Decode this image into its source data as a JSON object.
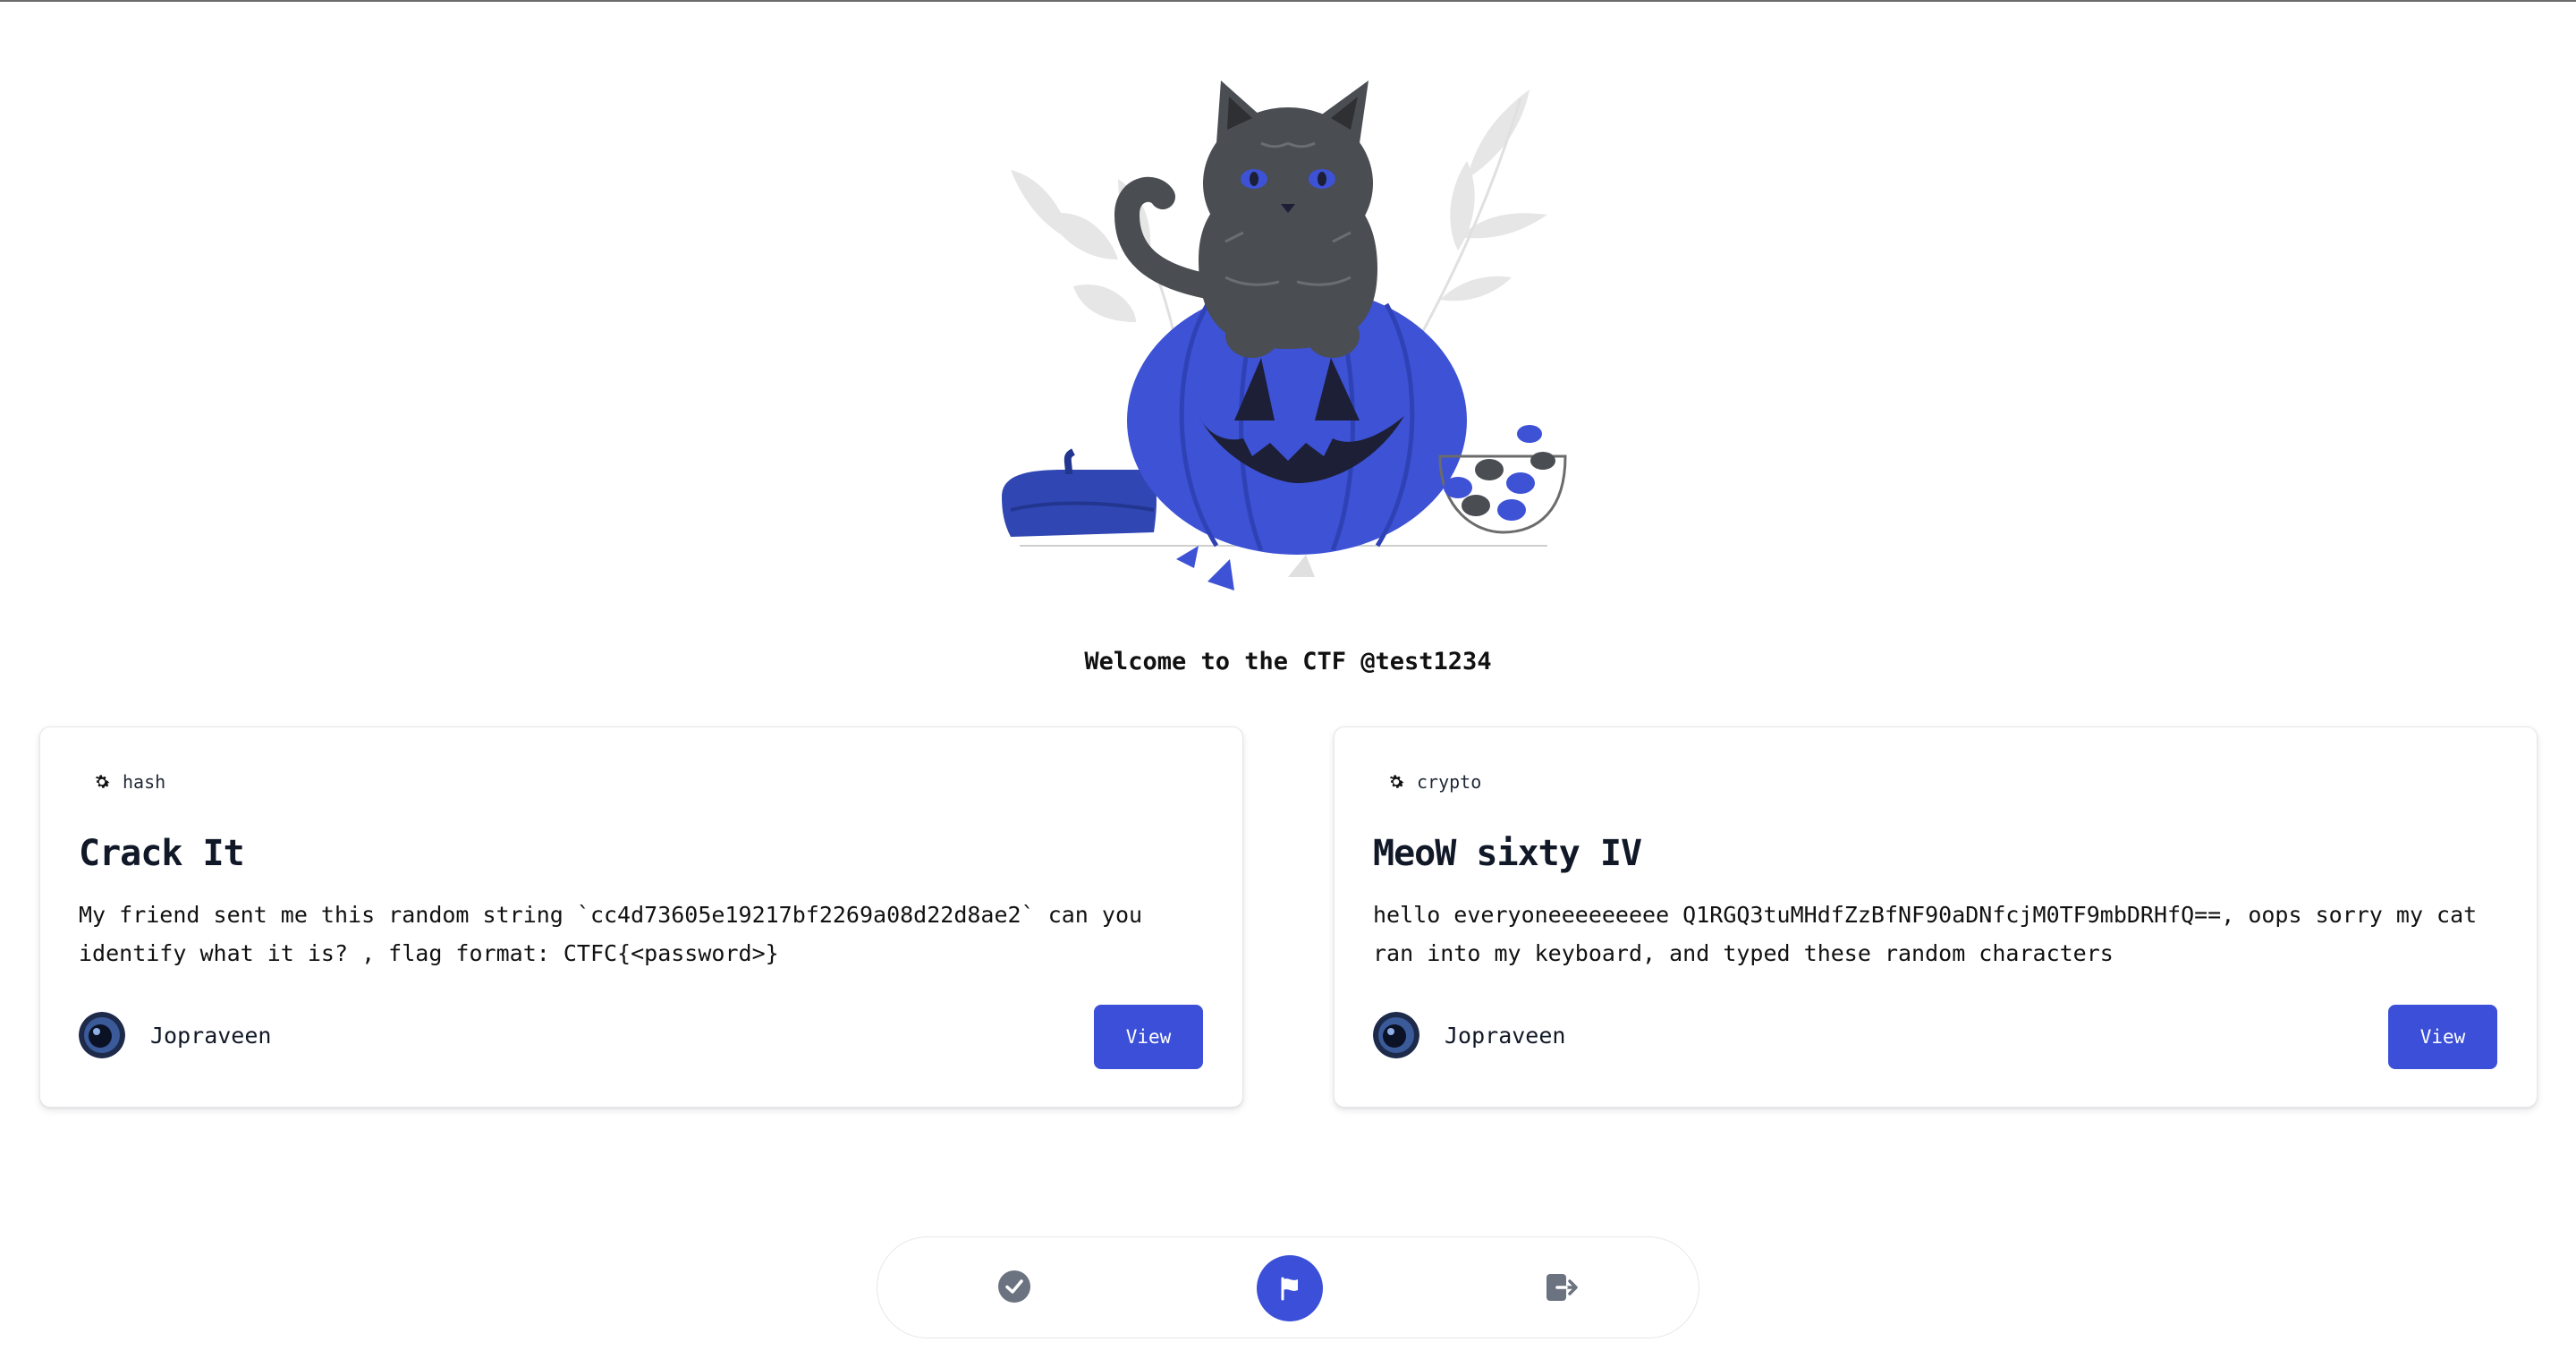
{
  "welcome_text": "Welcome to the CTF @test1234",
  "colors": {
    "accent": "#3b4fd8",
    "text": "#111827",
    "icon_gray": "#6b7280"
  },
  "challenges": [
    {
      "category": "hash",
      "category_icon": "gear-icon",
      "title": "Crack It",
      "description": "My friend sent me this random string `cc4d73605e19217bf2269a08d22d8ae2` can you identify what it is? , flag format: CTFC{<password>}",
      "author": "Jopraveen",
      "button_label": "View"
    },
    {
      "category": "crypto",
      "category_icon": "gear-icon",
      "title": "MeoW sixty IV",
      "description": "hello everyoneeeeeeeee Q1RGQ3tuMHdfZzBfNF90aDNfcjM0TF9mbDRHfQ==, oops sorry my cat ran into my keyboard, and typed these random characters",
      "author": "Jopraveen",
      "button_label": "View"
    }
  ],
  "bottom_nav": [
    {
      "name": "check-circle-icon",
      "active": false
    },
    {
      "name": "flag-icon",
      "active": true
    },
    {
      "name": "logout-icon",
      "active": false
    }
  ]
}
